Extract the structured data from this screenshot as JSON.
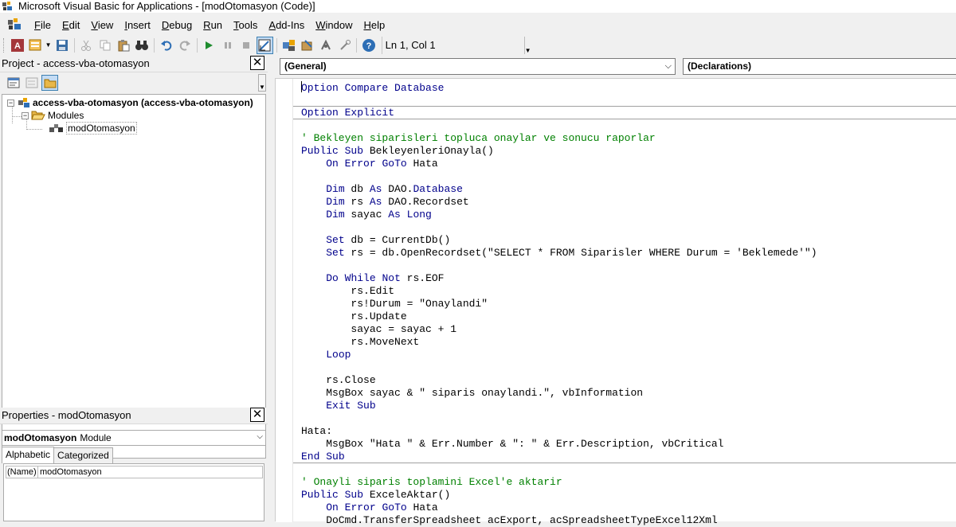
{
  "titlebar": {
    "title": "Microsoft Visual Basic for Applications - [modOtomasyon (Code)]"
  },
  "menu": {
    "items": [
      {
        "u": "F",
        "rest": "ile"
      },
      {
        "u": "E",
        "rest": "dit"
      },
      {
        "u": "V",
        "rest": "iew"
      },
      {
        "u": "I",
        "rest": "nsert"
      },
      {
        "u": "D",
        "rest": "ebug"
      },
      {
        "u": "R",
        "rest": "un"
      },
      {
        "u": "T",
        "rest": "ools"
      },
      {
        "u": "A",
        "rest": "dd-Ins"
      },
      {
        "u": "W",
        "rest": "indow"
      },
      {
        "u": "H",
        "rest": "elp"
      }
    ]
  },
  "toolbar": {
    "position": "Ln 1, Col 1"
  },
  "project": {
    "header": "Project - access-vba-otomasyon",
    "root": "access-vba-otomasyon (access-vba-otomasyon)",
    "folder": "Modules",
    "module": "modOtomasyon"
  },
  "properties": {
    "header": "Properties - modOtomasyon",
    "object_name": "modOtomasyon",
    "object_type": "Module",
    "tab_alpha": "Alphabetic",
    "tab_cat": "Categorized",
    "rows": [
      {
        "key": "(Name)",
        "value": "modOtomasyon"
      }
    ]
  },
  "code": {
    "object_dropdown": "(General)",
    "proc_dropdown": "(Declarations)",
    "lines": [
      {
        "t": "Option Compare Database",
        "k": 1,
        "caret": 1
      },
      {
        "t": "",
        "sep": 1
      },
      {
        "t": "Option Explicit",
        "k": 1,
        "sep": 1
      },
      {
        "t": ""
      },
      {
        "t": "' Bekleyen siparisleri topluca onaylar ve sonucu raporlar",
        "c": 1
      },
      {
        "t": "Public Sub BekleyenleriOnayla()"
      },
      {
        "t": "    On Error GoTo Hata"
      },
      {
        "t": ""
      },
      {
        "t": "    Dim db As DAO.Database"
      },
      {
        "t": "    Dim rs As DAO.Recordset"
      },
      {
        "t": "    Dim sayac As Long"
      },
      {
        "t": ""
      },
      {
        "t": "    Set db = CurrentDb()"
      },
      {
        "t": "    Set rs = db.OpenRecordset(\"SELECT * FROM Siparisler WHERE Durum = 'Beklemede'\")"
      },
      {
        "t": ""
      },
      {
        "t": "    Do While Not rs.EOF"
      },
      {
        "t": "        rs.Edit"
      },
      {
        "t": "        rs!Durum = \"Onaylandi\""
      },
      {
        "t": "        rs.Update"
      },
      {
        "t": "        sayac = sayac + 1"
      },
      {
        "t": "        rs.MoveNext"
      },
      {
        "t": "    Loop"
      },
      {
        "t": ""
      },
      {
        "t": "    rs.Close"
      },
      {
        "t": "    MsgBox sayac & \" siparis onaylandi.\", vbInformation"
      },
      {
        "t": "    Exit Sub"
      },
      {
        "t": ""
      },
      {
        "t": "Hata:"
      },
      {
        "t": "    MsgBox \"Hata \" & Err.Number & \": \" & Err.Description, vbCritical"
      },
      {
        "t": "End Sub",
        "sep": 1
      },
      {
        "t": ""
      },
      {
        "t": "' Onayli siparis toplamini Excel'e aktarir",
        "c": 1
      },
      {
        "t": "Public Sub ExceleAktar()"
      },
      {
        "t": "    On Error GoTo Hata"
      },
      {
        "t": "    DoCmd.TransferSpreadsheet acExport, acSpreadsheetTypeExcel12Xml"
      }
    ]
  }
}
